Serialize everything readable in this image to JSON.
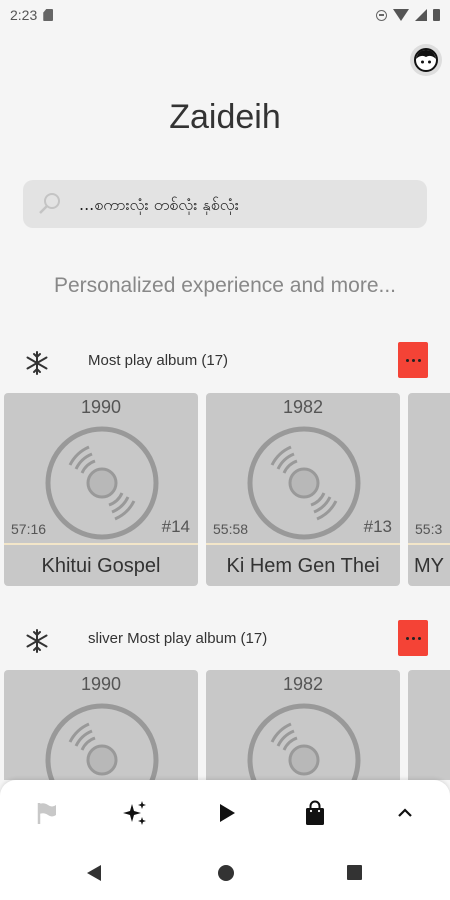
{
  "status_bar": {
    "time": "2:23"
  },
  "app": {
    "title": "Zaideih",
    "tagline": "Personalized experience and more..."
  },
  "search": {
    "placeholder": "...စကားလုံး တစ်လုံး နှစ်လုံး",
    "icon": "search-icon"
  },
  "sections": [
    {
      "title": "Most play album (17)",
      "albums": [
        {
          "year": "1990",
          "duration": "57:16",
          "rank": "#14",
          "name": "Khitui Gospel"
        },
        {
          "year": "1982",
          "duration": "55:58",
          "rank": "#13",
          "name": "Ki Hem Gen Thei"
        },
        {
          "year": "",
          "duration": "55:3",
          "rank": "",
          "name": "MY"
        }
      ]
    },
    {
      "title": "sliver Most play album (17)",
      "albums": [
        {
          "year": "1990",
          "duration": "",
          "rank": "",
          "name": ""
        },
        {
          "year": "1982",
          "duration": "",
          "rank": "",
          "name": ""
        },
        {
          "year": "",
          "duration": "",
          "rank": "",
          "name": ""
        }
      ]
    }
  ],
  "bottom_nav": [
    "flag-icon",
    "sparkle-icon",
    "play-icon",
    "shopping-bag-icon",
    "chevron-up-icon"
  ],
  "colors": {
    "accent": "#f44336",
    "card": "#c8c8c8",
    "background": "#f5f5f5"
  }
}
